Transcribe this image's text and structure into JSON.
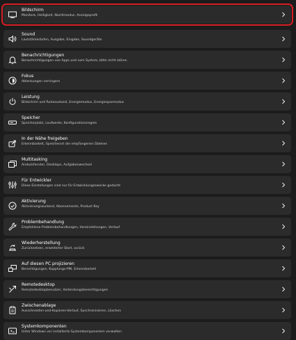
{
  "settings": {
    "items": [
      {
        "icon": "monitor-icon",
        "title": "Bildschirm",
        "desc": "Monitore, Helligkeit, Nachtmodus, Anzeigeprofil",
        "selected": true
      },
      {
        "icon": "speaker-icon",
        "title": "Sound",
        "desc": "Lautstärkestufen, Ausgabe, Eingabe, Soundgeräte"
      },
      {
        "icon": "bell-icon",
        "title": "Benachrichtigungen",
        "desc": "Benachrichtigungen von Apps und vom System, bitte nicht stören"
      },
      {
        "icon": "focus-icon",
        "title": "Fokus",
        "desc": "Ablenkungen verringern"
      },
      {
        "icon": "power-icon",
        "title": "Leistung",
        "desc": "Bildschirm und Ruhezustand, Energiemodus, Energiesparmodus"
      },
      {
        "icon": "storage-icon",
        "title": "Speicher",
        "desc": "Speicherplatz, Laufwerke, Konfigurationsregeln"
      },
      {
        "icon": "share-icon",
        "title": "In der Nähe freigeben",
        "desc": "Erkennbarkeit, Speicherort der empfangenen Dateien"
      },
      {
        "icon": "multitask-icon",
        "title": "Multitasking",
        "desc": "Andockfenster, Desktops, Aufgabenwechsel"
      },
      {
        "icon": "developer-icon",
        "title": "Für Entwickler",
        "desc": "Diese Einstellungen sind nur für Entwicklungszwecke gedacht"
      },
      {
        "icon": "check-circle-icon",
        "title": "Aktivierung",
        "desc": "Aktivierungszustand, Abonnements, Product Key"
      },
      {
        "icon": "wrench-icon",
        "title": "Problembehandlung",
        "desc": "Empfohlene Problembehandlungen, Voreinstellungen, Verlauf"
      },
      {
        "icon": "recovery-icon",
        "title": "Wiederherstellung",
        "desc": "Zurücksetzen, erweiterter Start, zurück"
      },
      {
        "icon": "project-icon",
        "title": "Auf diesen PC projizieren",
        "desc": "Berechtigungen, Kopplungs-PIN, Erkennbarkeit"
      },
      {
        "icon": "remote-desktop-icon",
        "title": "Remotedesktop",
        "desc": "Remotedesktopbenutzer, Verbindungsberechtigungen"
      },
      {
        "icon": "clipboard-icon",
        "title": "Zwischenablage",
        "desc": "Ausschneiden-und-Kopieren-Verlauf, Synchronisieren, Löschen"
      },
      {
        "icon": "components-icon",
        "title": "Systemkomponenten",
        "desc": "Unter Windows vor installierte Systemkomponenten verwalten"
      }
    ]
  },
  "colors": {
    "accent": "#d81f26",
    "row_bg": "#2b2b2b",
    "bg": "#1c1c1c"
  }
}
